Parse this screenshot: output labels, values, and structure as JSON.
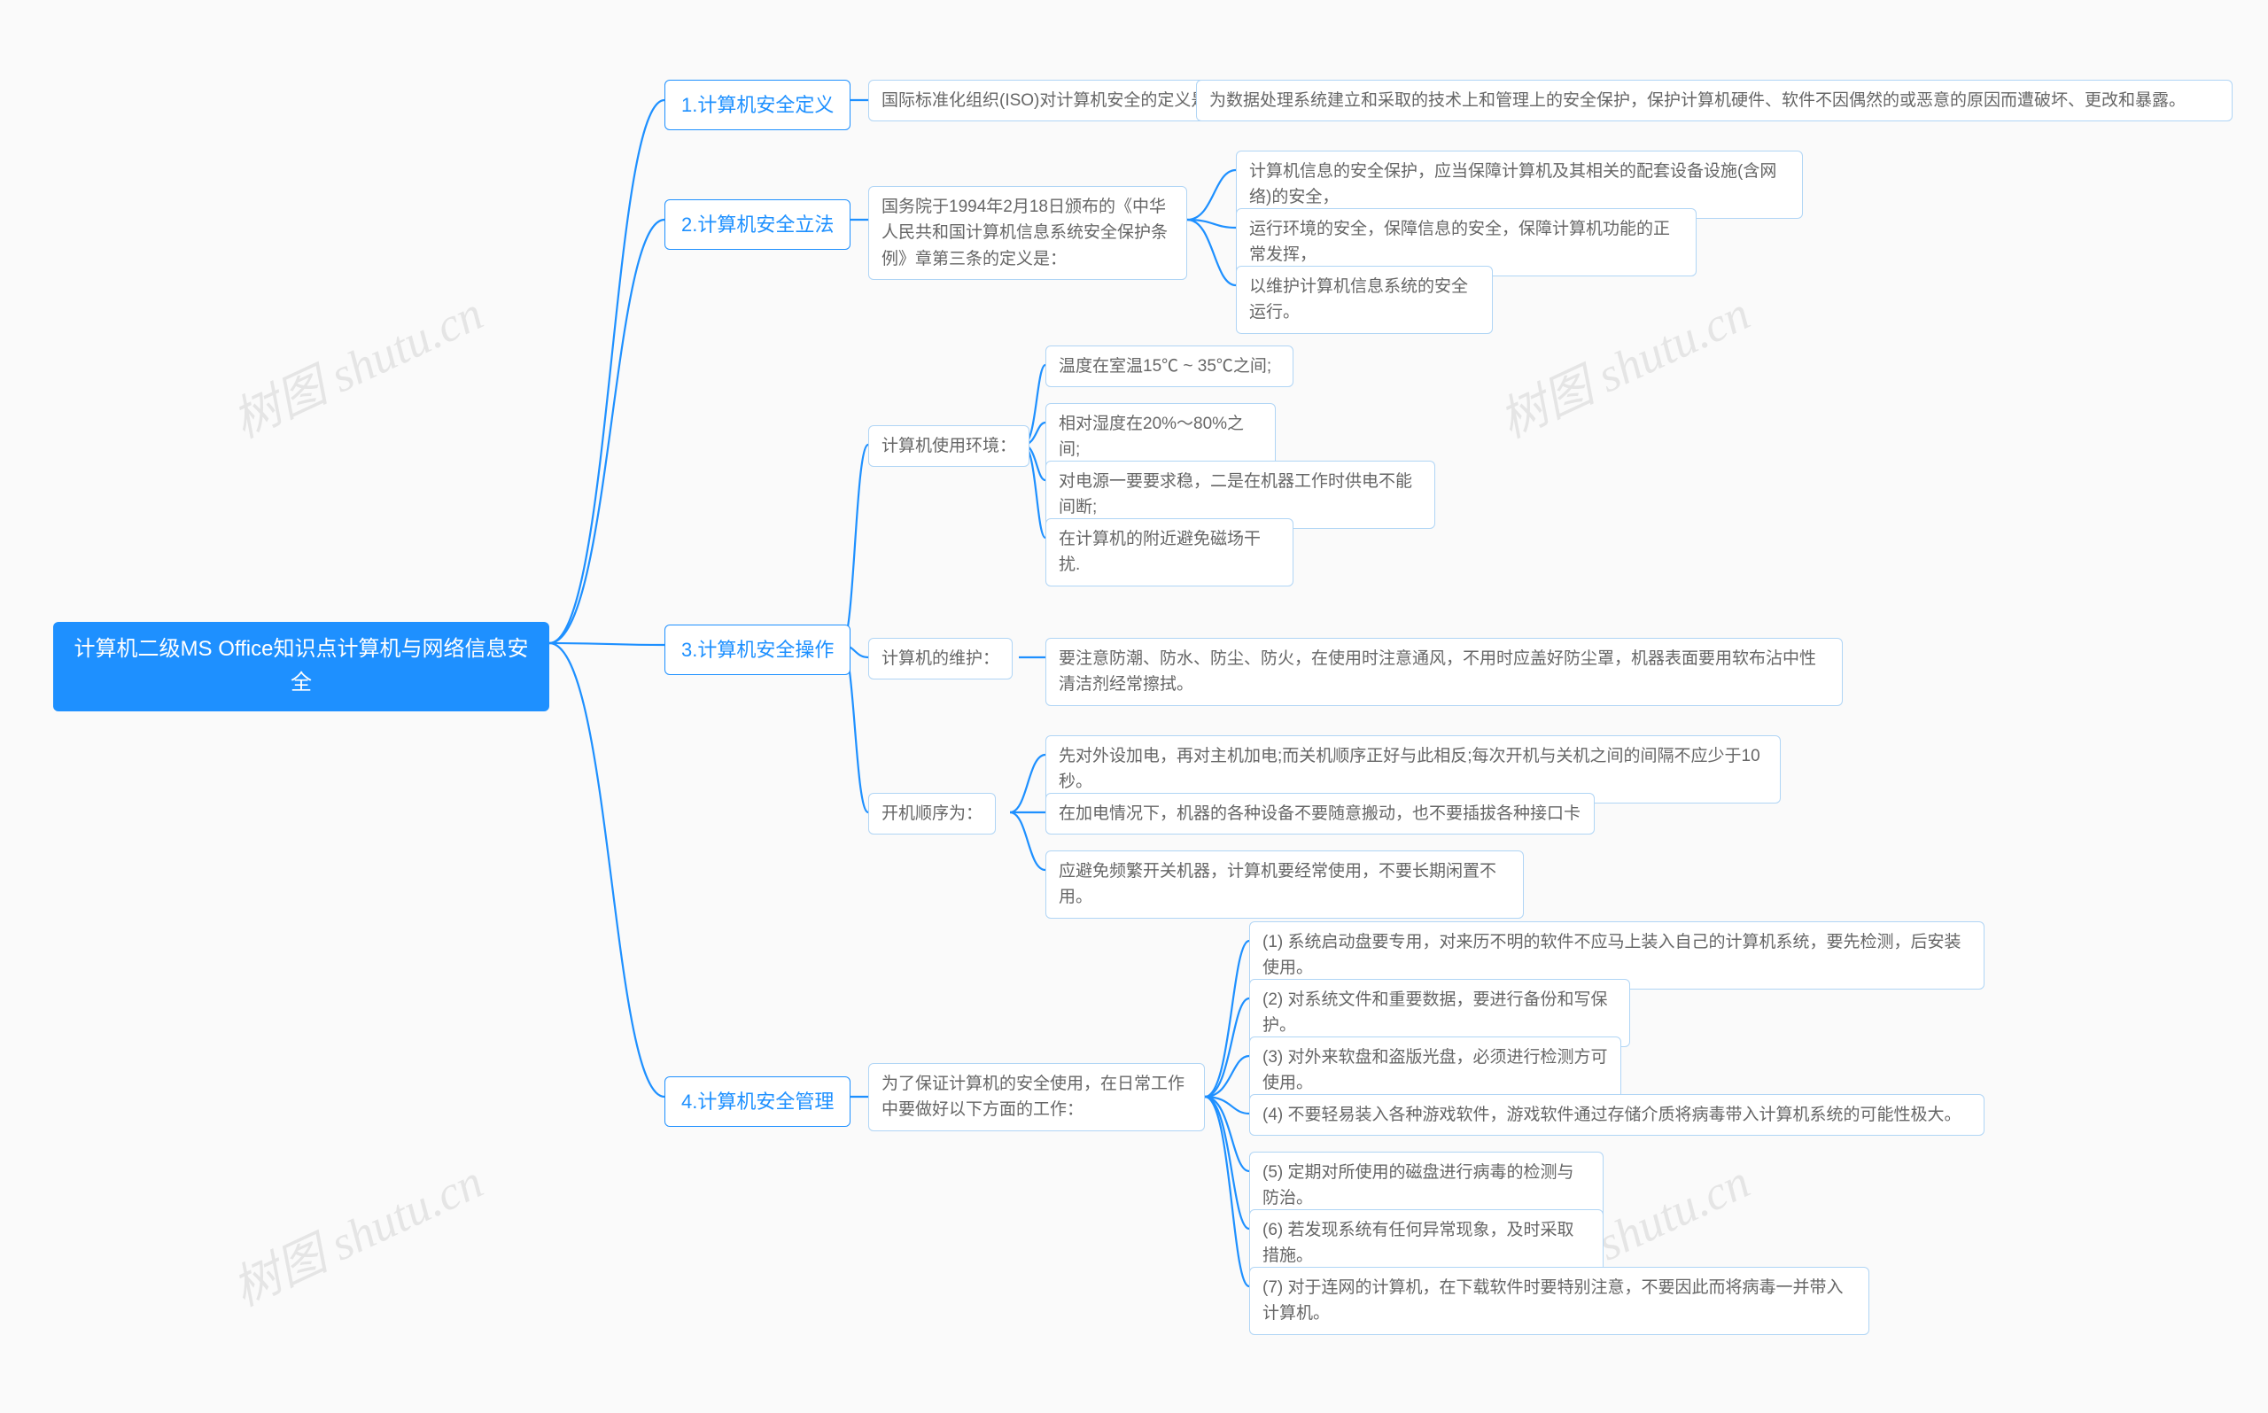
{
  "watermark": "树图 shutu.cn",
  "root": "计算机二级MS Office知识点计算机与网络信息安全",
  "b1": {
    "label": "1.计算机安全定义",
    "c1": "国际标准化组织(ISO)对计算机安全的定义是：",
    "c1a": "为数据处理系统建立和采取的技术上和管理上的安全保护，保护计算机硬件、软件不因偶然的或恶意的原因而遭破坏、更改和暴露。"
  },
  "b2": {
    "label": "2.计算机安全立法",
    "c1": "国务院于1994年2月18日颁布的《中华人民共和国计算机信息系统安全保护条例》章第三条的定义是：",
    "c1a": "计算机信息的安全保护，应当保障计算机及其相关的配套设备设施(含网络)的安全，",
    "c1b": "运行环境的安全，保障信息的安全，保障计算机功能的正常发挥，",
    "c1c": "以维护计算机信息系统的安全运行。"
  },
  "b3": {
    "label": "3.计算机安全操作",
    "c1": {
      "label": "计算机使用环境：",
      "a": "温度在室温15℃ ~ 35℃之间;",
      "b": "相对湿度在20%～80%之间;",
      "c": "对电源一要要求稳，二是在机器工作时供电不能间断;",
      "d": "在计算机的附近避免磁场干扰."
    },
    "c2": {
      "label": "计算机的维护：",
      "a": "要注意防潮、防水、防尘、防火，在使用时注意通风，不用时应盖好防尘罩，机器表面要用软布沾中性清洁剂经常擦拭。"
    },
    "c3": {
      "label": "开机顺序为：",
      "a": "先对外设加电，再对主机加电;而关机顺序正好与此相反;每次开机与关机之间的间隔不应少于10秒。",
      "b": "在加电情况下，机器的各种设备不要随意搬动，也不要插拔各种接口卡",
      "c": "应避免频繁开关机器，计算机要经常使用，不要长期闲置不用。"
    }
  },
  "b4": {
    "label": "4.计算机安全管理",
    "c1": "为了保证计算机的安全使用，在日常工作中要做好以下方面的工作：",
    "c1a": "(1) 系统启动盘要专用，对来历不明的软件不应马上装入自己的计算机系统，要先检测，后安装使用。",
    "c1b": "(2) 对系统文件和重要数据，要进行备份和写保护。",
    "c1c": "(3) 对外来软盘和盗版光盘，必须进行检测方可使用。",
    "c1d": "(4) 不要轻易装入各种游戏软件，游戏软件通过存储介质将病毒带入计算机系统的可能性极大。",
    "c1e": "(5) 定期对所使用的磁盘进行病毒的检测与防治。",
    "c1f": "(6) 若发现系统有任何异常现象，及时采取措施。",
    "c1g": "(7) 对于连网的计算机，在下载软件时要特别注意，不要因此而将病毒一并带入计算机。"
  }
}
